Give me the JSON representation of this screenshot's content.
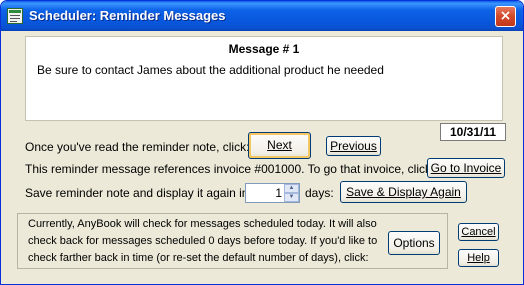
{
  "window": {
    "title": "Scheduler: Reminder Messages",
    "close_glyph": "×"
  },
  "message": {
    "heading": "Message # 1",
    "body": "Be sure to contact James about the additional product he needed"
  },
  "date": "10/31/11",
  "rows": {
    "read_note": "Once you've read the reminder note, click:",
    "invoice_ref": "This reminder message references invoice #001000.  To go that invoice, click:",
    "save_prefix": "Save reminder note and display it again in",
    "save_suffix": "days:"
  },
  "buttons": {
    "next": "Next",
    "previous": "Previous",
    "go_to_invoice": "Go to Invoice",
    "save_display_again": "Save & Display Again",
    "options": "Options",
    "cancel": "Cancel",
    "help": "Help"
  },
  "spinner": {
    "value": "1",
    "up_glyph": "▲",
    "down_glyph": "▼"
  },
  "info": {
    "line1": "Currently, AnyBook will check for messages scheduled today.  It will also",
    "line2": "check back for messages scheduled 0 days before today.  If you'd like to",
    "line3": "check farther back in time (or re-set the default number of days), click:"
  },
  "colors": {
    "titlebar": "#0857dc",
    "window_bg": "#ece9d8",
    "close_button": "#d3492a",
    "default_button_highlight": "#f5c763"
  },
  "icons": {
    "app": "scheduler-app-icon",
    "close": "close-icon"
  }
}
